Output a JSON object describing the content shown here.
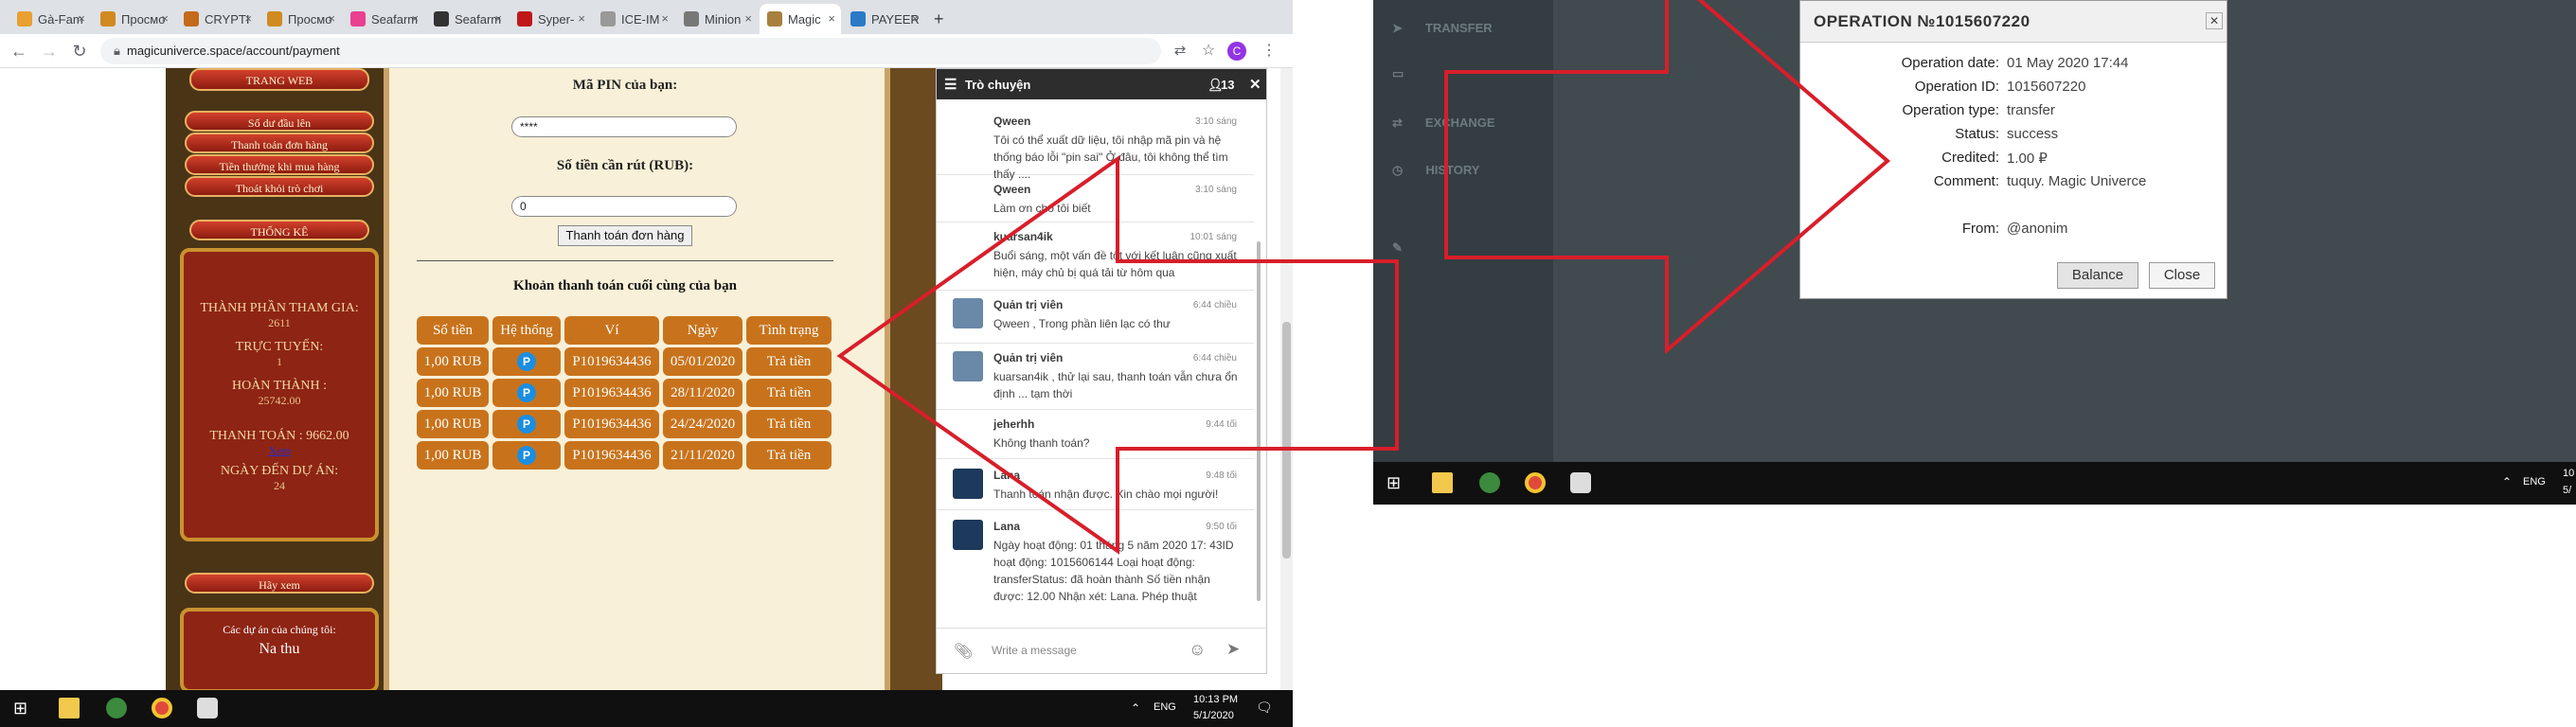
{
  "browser": {
    "tabs": [
      {
        "label": "Gà-Fam",
        "color": "#e8a030"
      },
      {
        "label": "Просмо",
        "color": "#d08a20"
      },
      {
        "label": "CRYPTI",
        "color": "#c46a1a"
      },
      {
        "label": "Просмо",
        "color": "#d08a20"
      },
      {
        "label": "Seafarm",
        "color": "#e94090"
      },
      {
        "label": "Seafarm",
        "color": "#333333"
      },
      {
        "label": "Syper-",
        "color": "#c01818"
      },
      {
        "label": "ICE-IM",
        "color": "#999999"
      },
      {
        "label": "Minion",
        "color": "#777777"
      },
      {
        "label": "Magic",
        "color": "#a88040"
      },
      {
        "label": "PAYEER",
        "color": "#2a7ac8"
      }
    ],
    "new_tab": "+",
    "url": "magicuniverce.space/account/payment",
    "profile_initial": "C"
  },
  "sidebar": {
    "menu": [
      "TRANG WEB",
      "Số dư đầu lên",
      "Thanh toán đơn hàng",
      "Tiền thưởng khi mua hàng",
      "Thoát khỏi trò chơi",
      "THỐNG KÊ"
    ],
    "stats": {
      "participants_label": "THÀNH PHẦN THAM GIA:",
      "participants_value": "2611",
      "online_label": "TRỰC TUYẾN:",
      "online_value": "1",
      "completed_label": "HOÀN THÀNH :",
      "completed_value": "25742.00",
      "paid_label": "THANH TOÁN : 9662.00",
      "link": "Xem",
      "days_label": "NGÀY ĐẾN DỰ ÁN:",
      "days_value": "24"
    },
    "view_button": "Hãy xem",
    "project_title": "Các dự án của chúng tôi:",
    "project_name": "Na thu"
  },
  "form": {
    "pin_label": "Mã PIN của bạn:",
    "pin_value": "****",
    "amount_label": "Số tiền cần rút (RUB):",
    "amount_value": "0",
    "submit": "Thanh toán đơn hàng",
    "table_title": "Khoản thanh toán cuối cùng của bạn"
  },
  "payments": {
    "headers": [
      "Số tiền",
      "Hệ thống",
      "Ví",
      "Ngày",
      "Tình trạng"
    ],
    "rows": [
      {
        "amount": "1,00 RUB",
        "system": "P",
        "wallet": "P1019634436",
        "date": "05/01/2020",
        "status": "Trả tiền"
      },
      {
        "amount": "1,00 RUB",
        "system": "P",
        "wallet": "P1019634436",
        "date": "28/11/2020",
        "status": "Trả tiền"
      },
      {
        "amount": "1,00 RUB",
        "system": "P",
        "wallet": "P1019634436",
        "date": "24/24/2020",
        "status": "Trả tiền"
      },
      {
        "amount": "1,00 RUB",
        "system": "P",
        "wallet": "P1019634436",
        "date": "21/11/2020",
        "status": "Trả tiền"
      }
    ]
  },
  "chat": {
    "title": "Trò chuyện",
    "users": "13",
    "placeholder": "Write a message",
    "messages": [
      {
        "name": "Qween",
        "time": "3:10 sáng",
        "text": "Tôi có thể xuất dữ liệu, tôi nhập mã pin và hệ thống báo lỗi \"pin sai\" Ở đâu, tôi không thể tìm thấy ....",
        "avatar": ""
      },
      {
        "name": "Qween",
        "time": "3:10 sáng",
        "text": "Làm ơn cho tôi biết",
        "avatar": ""
      },
      {
        "name": "kuarsan4ik",
        "time": "10:01 sáng",
        "text": "Buổi sáng, một vấn đề tốt với kết luận cũng xuất hiện, máy chủ bị quá tải từ hôm qua",
        "avatar": ""
      },
      {
        "name": "Quản trị viên",
        "time": "6:44 chiều",
        "text": "Qween , Trong phần liên lạc có thư",
        "avatar": "#6a88a8"
      },
      {
        "name": "Quản trị viên",
        "time": "6:44 chiều",
        "text": "kuarsan4ik , thử lại sau, thanh toán vẫn chưa ổn định ... tạm thời",
        "avatar": "#6a88a8"
      },
      {
        "name": "jeherhh",
        "time": "9:44 tối",
        "text": "Không thanh toán?",
        "avatar": ""
      },
      {
        "name": "Lana",
        "time": "9:48 tối",
        "text": "Thanh toán nhận được. Xin chào mọi người!",
        "avatar": "#1d3a5c"
      },
      {
        "name": "Lana",
        "time": "9:50 tối",
        "text": "Ngày hoạt động: 01 tháng 5 năm 2020 17: 43ID hoạt động: 1015606144 Loại hoạt động: transferStatus: đã hoàn thành Số tiền nhận được: 12.00 Nhận xét: Lana. Phép thuật",
        "avatar": "#1d3a5c"
      }
    ]
  },
  "taskbar_left": {
    "lang": "ENG",
    "time": "10:13 PM",
    "date": "5/1/2020"
  },
  "operation": {
    "title": "OPERATION №1015607220",
    "fields": [
      {
        "label": "Operation date:",
        "value": "01 May 2020 17:44"
      },
      {
        "label": "Operation ID:",
        "value": "1015607220"
      },
      {
        "label": "Operation type:",
        "value": "transfer"
      },
      {
        "label": "Status:",
        "value": "success"
      },
      {
        "label": "Credited:",
        "value": "1.00 ₽"
      },
      {
        "label": "Comment:",
        "value": "tuquy. Magic Univerce"
      },
      {
        "label": "From:",
        "value": "@anonim"
      }
    ],
    "balance_button": "Balance",
    "close_button": "Close"
  },
  "right_sidebar": [
    "TRANSFER",
    "",
    "EXCHANGE",
    "",
    "HISTORY"
  ],
  "taskbar_right": {
    "lang": "ENG",
    "time": "10",
    "date": "5/"
  },
  "colors": {
    "arrow": "#d81e2a",
    "table_cell": "#c8731c",
    "chat_header": "#2d2d2d"
  }
}
